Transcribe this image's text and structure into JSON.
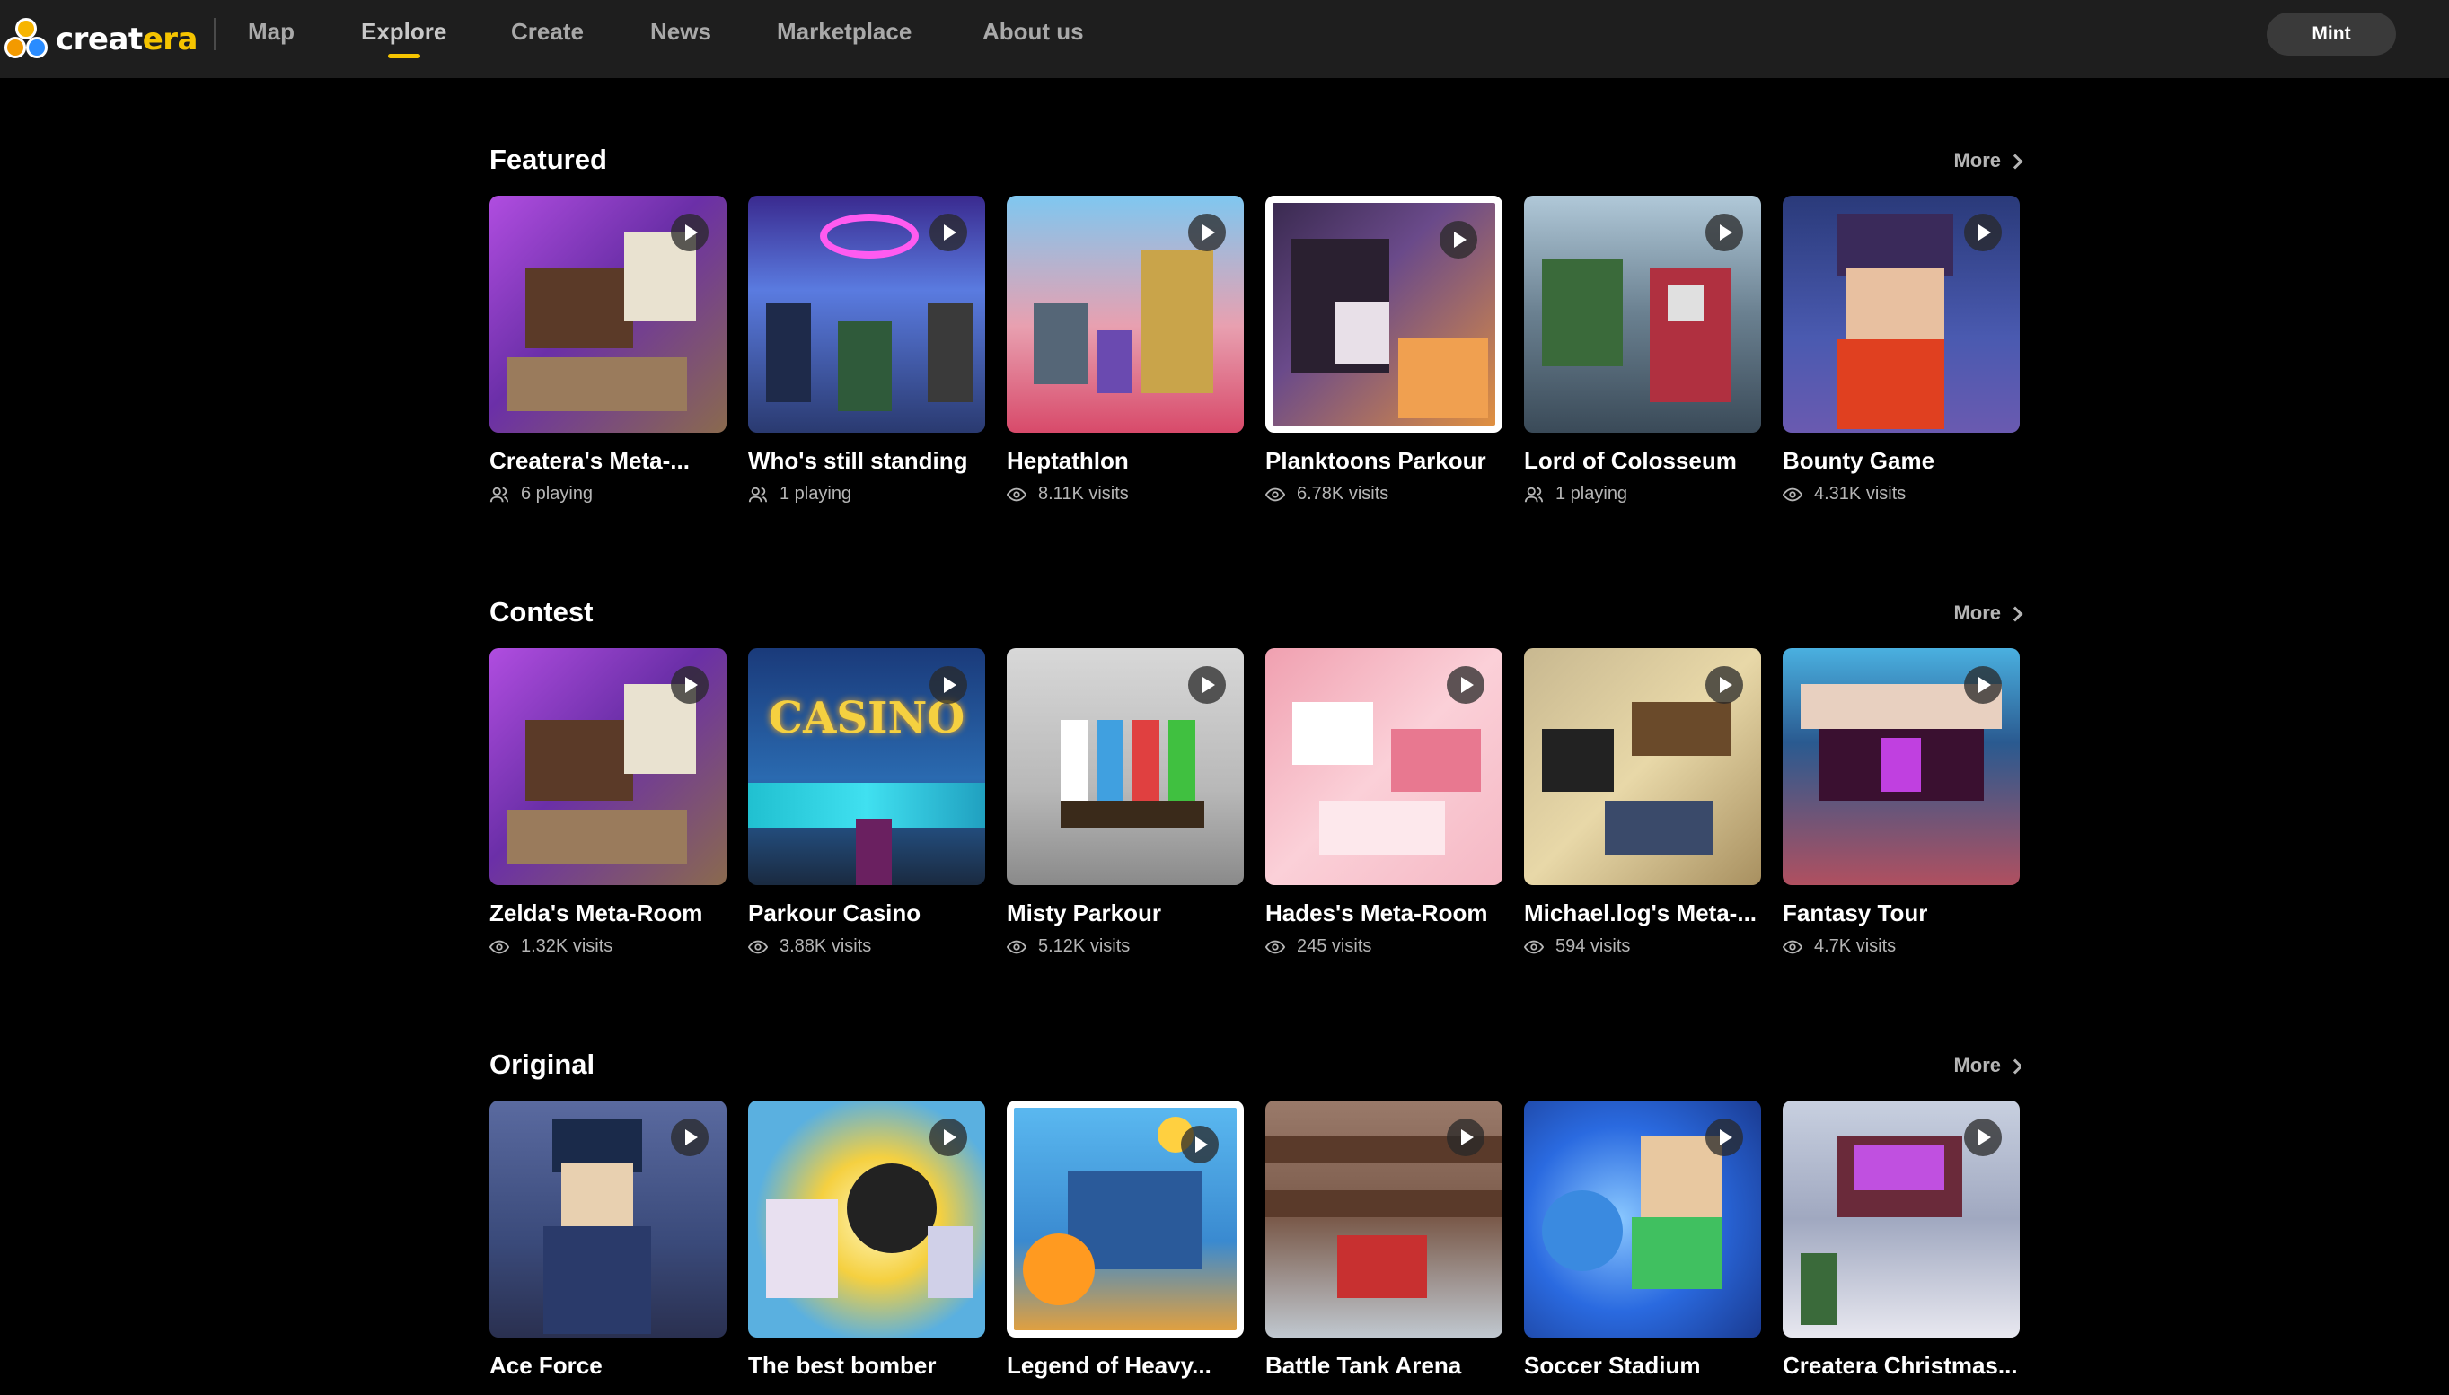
{
  "nav": {
    "logo_text_a": "creat",
    "logo_text_b": "era",
    "links": [
      {
        "label": "Map"
      },
      {
        "label": "Explore",
        "active": true
      },
      {
        "label": "Create"
      },
      {
        "label": "News"
      },
      {
        "label": "Marketplace"
      },
      {
        "label": "About us"
      }
    ],
    "mint_label": "Mint",
    "accent_color": "#f5c400"
  },
  "sections": [
    {
      "title": "Featured",
      "more_label": "More",
      "cards": [
        {
          "title": "Createra's Meta-...",
          "stat": "6 playing",
          "stat_icon": "players-icon"
        },
        {
          "title": "Who's still standing",
          "stat": "1 playing",
          "stat_icon": "players-icon"
        },
        {
          "title": "Heptathlon",
          "stat": "8.11K visits",
          "stat_icon": "eye-icon"
        },
        {
          "title": "Planktoons Parkour",
          "stat": "6.78K visits",
          "stat_icon": "eye-icon"
        },
        {
          "title": "Lord of Colosseum",
          "stat": "1 playing",
          "stat_icon": "players-icon"
        },
        {
          "title": "Bounty Game",
          "stat": "4.31K visits",
          "stat_icon": "eye-icon"
        }
      ]
    },
    {
      "title": "Contest",
      "more_label": "More",
      "cards": [
        {
          "title": "Zelda's Meta-Room",
          "stat": "1.32K visits",
          "stat_icon": "eye-icon"
        },
        {
          "title": "Parkour Casino",
          "stat": "3.88K visits",
          "stat_icon": "eye-icon",
          "thumb_text": "CASINO"
        },
        {
          "title": "Misty Parkour",
          "stat": "5.12K visits",
          "stat_icon": "eye-icon"
        },
        {
          "title": "Hades's Meta-Room",
          "stat": "245 visits",
          "stat_icon": "eye-icon"
        },
        {
          "title": "Michael.log's Meta-...",
          "stat": "594 visits",
          "stat_icon": "eye-icon"
        },
        {
          "title": "Fantasy Tour",
          "stat": "4.7K visits",
          "stat_icon": "eye-icon"
        }
      ]
    },
    {
      "title": "Original",
      "more_label": "More",
      "cards": [
        {
          "title": "Ace Force"
        },
        {
          "title": "The best bomber"
        },
        {
          "title": "Legend of Heavy..."
        },
        {
          "title": "Battle Tank Arena"
        },
        {
          "title": "Soccer Stadium"
        },
        {
          "title": "Createra Christmas..."
        }
      ]
    }
  ]
}
